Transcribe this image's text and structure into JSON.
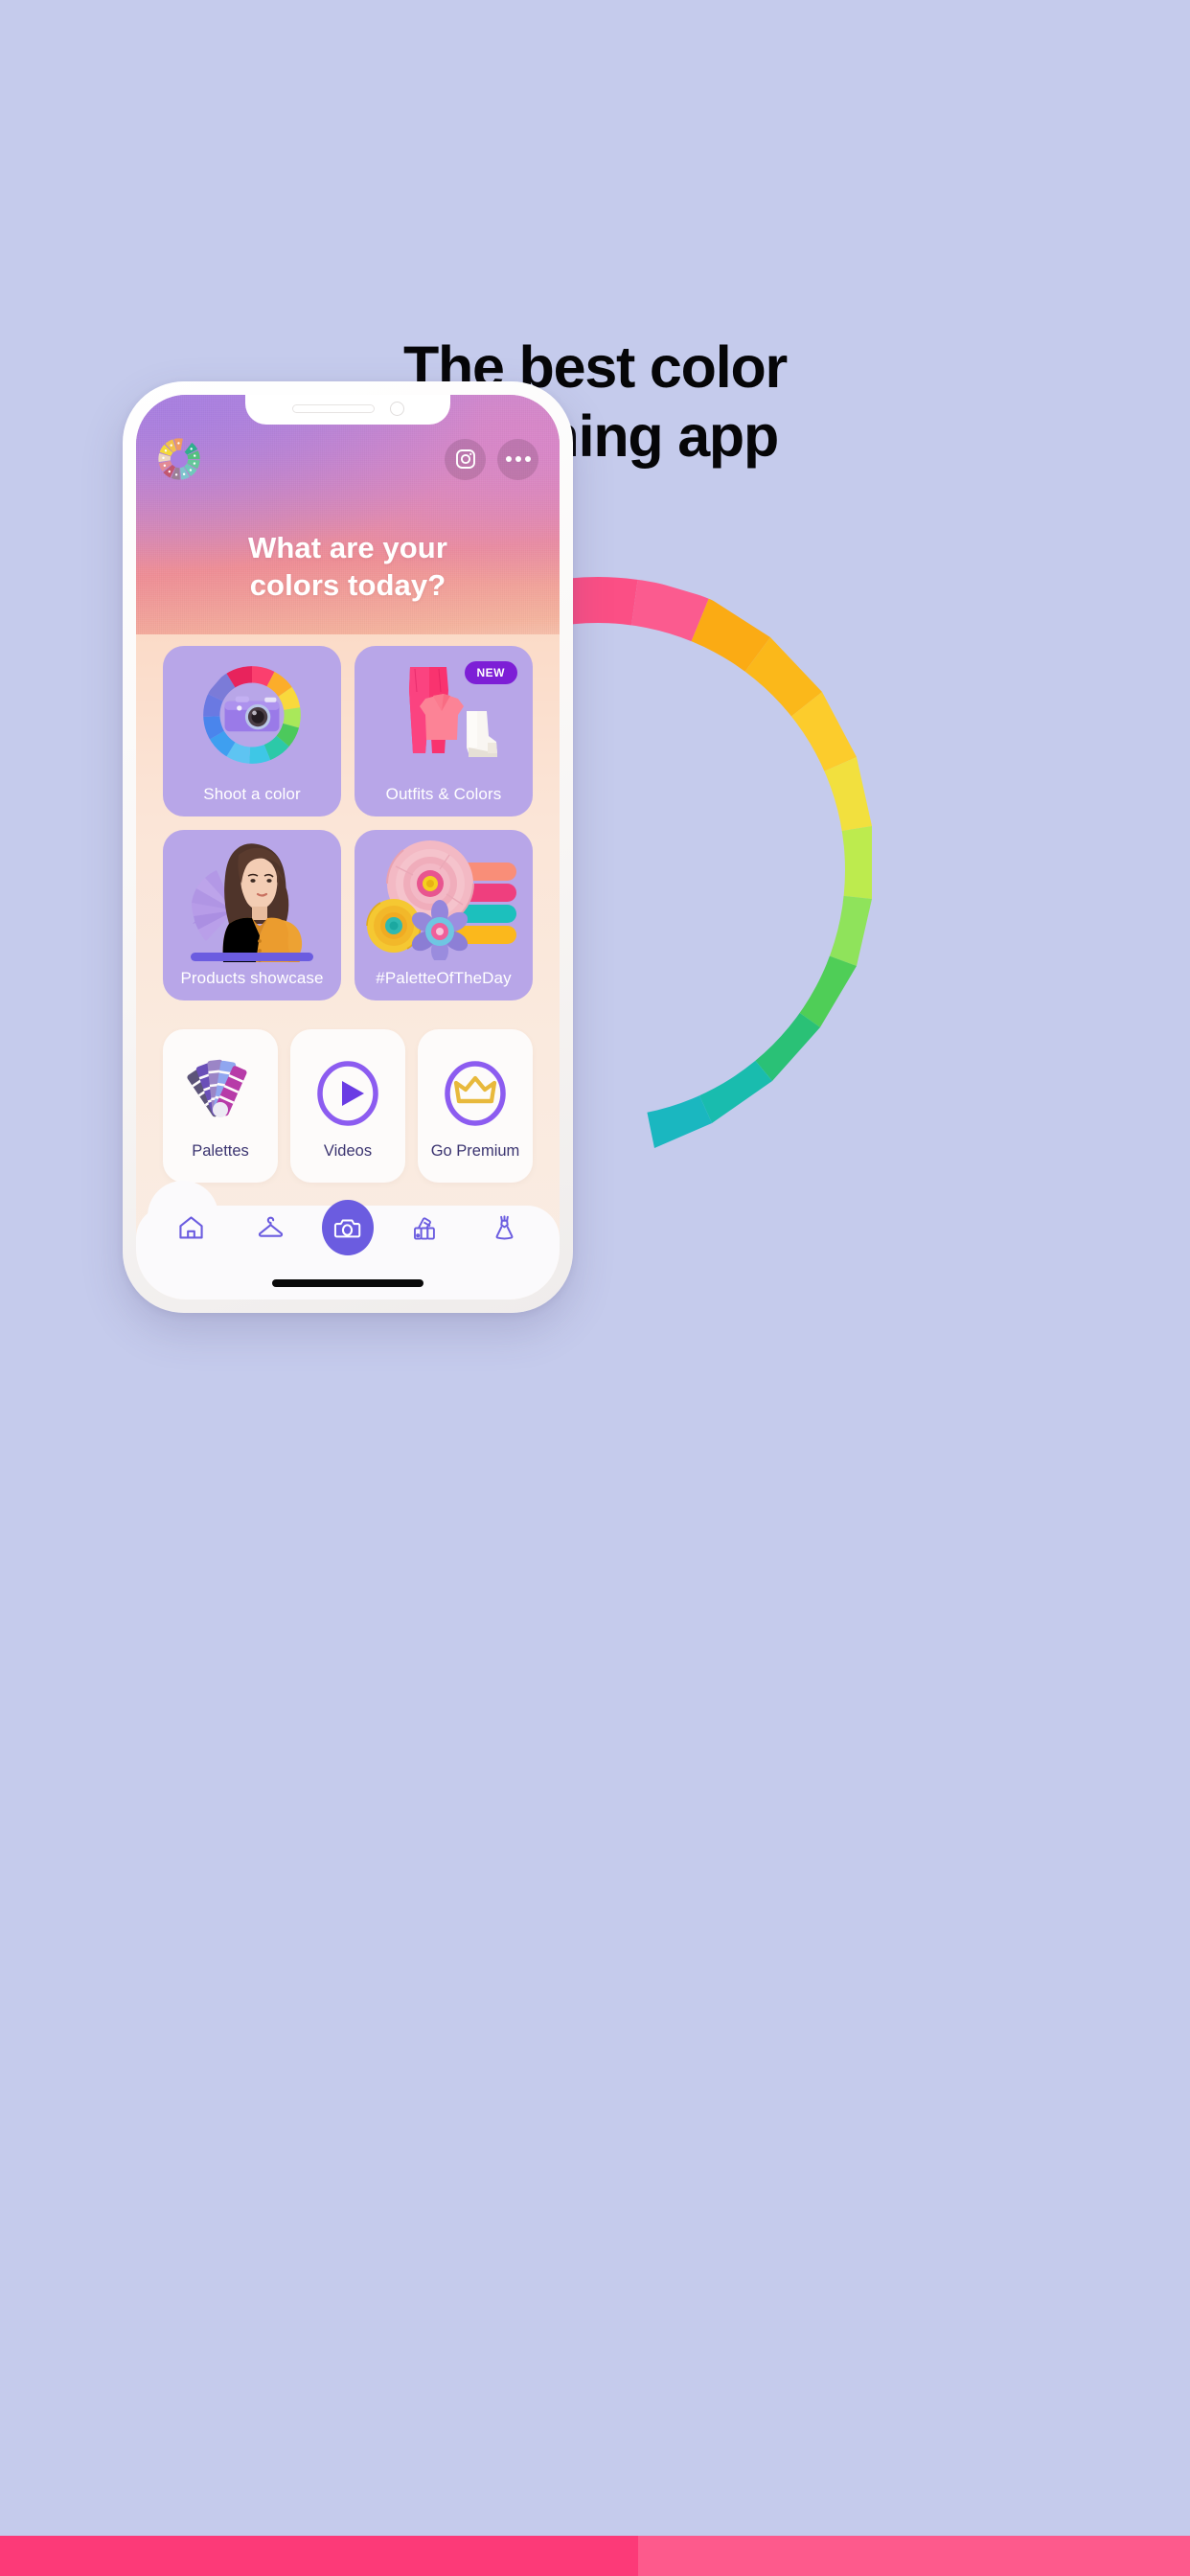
{
  "promo": {
    "headline_line1": "The best color",
    "headline_line2": "matching app",
    "background_color": "#c5cbec",
    "band_color_left": "#fc3a78",
    "band_color_right": "#fd5a8c"
  },
  "wheel_arc": {
    "name": "color-wheel-arc",
    "segments": [
      "#8e63d6",
      "#e81455",
      "#f6246b",
      "#fb4d82",
      "#fb5d91",
      "#fbb216",
      "#fcc92a",
      "#f5e03c",
      "#bfec4e",
      "#8ee25a",
      "#52cf5a",
      "#27c07a",
      "#18bdb0"
    ]
  },
  "phone": {
    "status": {
      "speaker": "speaker-grille",
      "camera": "front-camera"
    },
    "topbar": {
      "logo_name": "colors-app-logo",
      "instagram_label": "instagram-icon",
      "more_label": "more-options-icon"
    },
    "hero": {
      "title_line1": "What are your",
      "title_line2": "colors today?"
    },
    "tiles": [
      {
        "id": "shoot-a-color",
        "label": "Shoot a color",
        "art": "color-wheel-camera",
        "badge": null
      },
      {
        "id": "outfits-and-colors",
        "label": "Outfits & Colors",
        "art": "outfit-pants-top-boot",
        "badge": "NEW"
      },
      {
        "id": "products-showcase",
        "label": "Products showcase",
        "art": "model-orange-dress",
        "badge": null
      },
      {
        "id": "palette-of-the-day",
        "label": "#PaletteOfTheDay",
        "art": "paper-flowers-swatches",
        "badge": null
      }
    ],
    "quick_cards": [
      {
        "id": "palettes",
        "label": "Palettes",
        "art": "swatch-fan-icon"
      },
      {
        "id": "videos",
        "label": "Videos",
        "art": "play-circle-icon"
      },
      {
        "id": "go-premium",
        "label": "Go Premium",
        "art": "crown-circle-icon"
      }
    ],
    "bottom_nav": [
      {
        "id": "home",
        "icon": "home-icon",
        "active": false
      },
      {
        "id": "wardrobe",
        "icon": "hanger-icon",
        "active": false
      },
      {
        "id": "camera",
        "icon": "camera-icon",
        "active": true
      },
      {
        "id": "palettes",
        "icon": "swatch-fan-icon",
        "active": false
      },
      {
        "id": "outfits",
        "icon": "dress-icon",
        "active": false
      }
    ],
    "accent_color": "#6b5ce0",
    "tile_color": "#b8a6e8",
    "badge_color": "#7d1fd6"
  }
}
